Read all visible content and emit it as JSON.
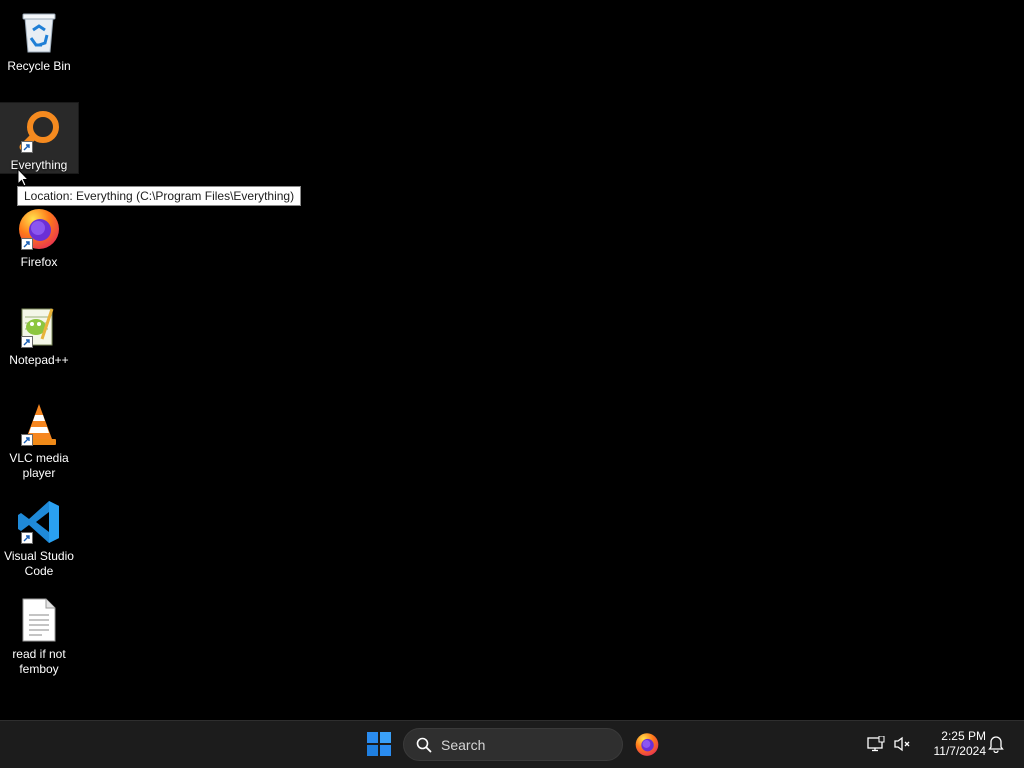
{
  "desktop": {
    "icons": [
      {
        "label": "Recycle Bin",
        "icon": "recycle-bin-icon"
      },
      {
        "label": "Everything",
        "icon": "everything-icon"
      },
      {
        "label": "Firefox",
        "icon": "firefox-icon"
      },
      {
        "label": "Notepad++",
        "icon": "notepad-plus-plus-icon"
      },
      {
        "label": "VLC media player",
        "icon": "vlc-icon"
      },
      {
        "label": "Visual Studio Code",
        "icon": "vscode-icon"
      },
      {
        "label": "read if not femboy",
        "icon": "text-file-icon"
      }
    ],
    "selected_icon": "Everything",
    "tooltip": "Location: Everything (C:\\Program Files\\Everything)"
  },
  "taskbar": {
    "search_placeholder": "Search",
    "pinned": [
      {
        "name": "Firefox",
        "icon": "firefox-icon"
      }
    ],
    "tray": {
      "icons": [
        "network-icon",
        "volume-muted-icon",
        "notification-bell-icon"
      ],
      "time": "2:25 PM",
      "date": "11/7/2024"
    }
  },
  "colors": {
    "desktop_bg": "#000000",
    "taskbar_bg": "#1c1c1c",
    "start_blue": "#2a8cf0"
  }
}
